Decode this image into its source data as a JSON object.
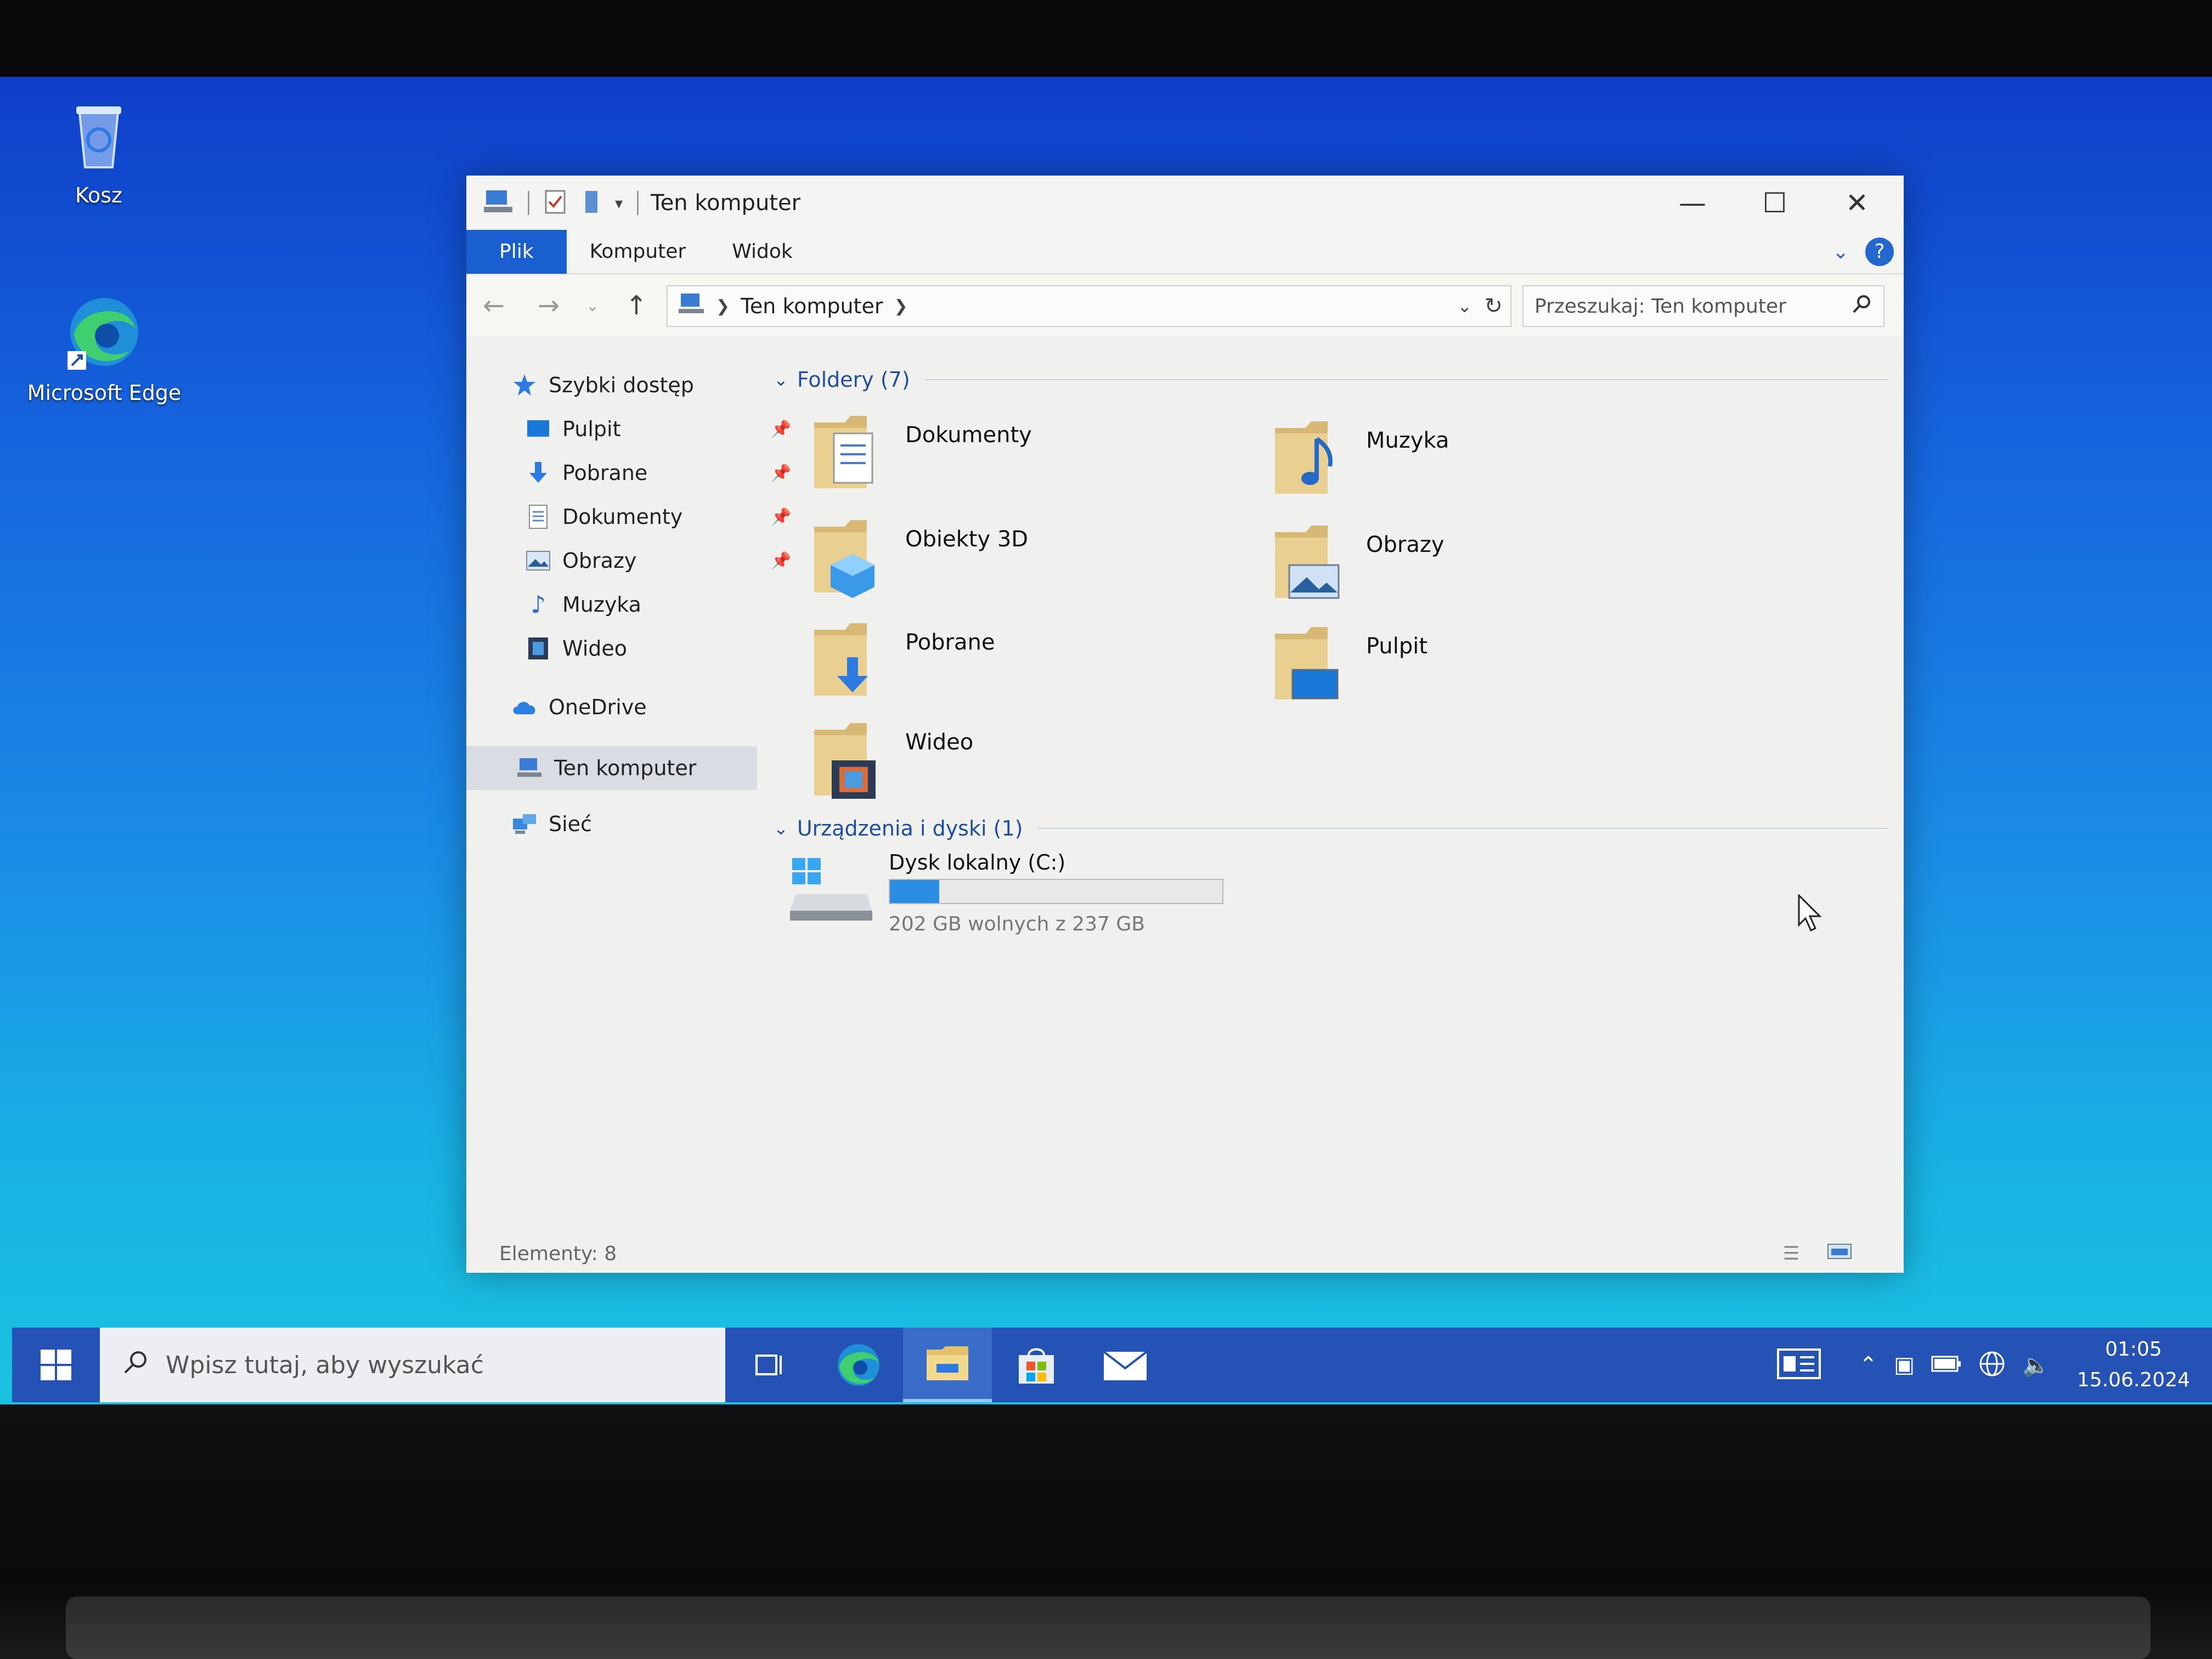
{
  "desktop": {
    "icons": [
      {
        "label": "Kosz",
        "icon": "recycle-bin-icon"
      },
      {
        "label": "Microsoft Edge",
        "icon": "edge-icon"
      }
    ]
  },
  "window": {
    "title": "Ten komputer",
    "ribbon_tabs": [
      "Plik",
      "Komputer",
      "Widok"
    ],
    "address": {
      "location": "Ten komputer"
    },
    "search_placeholder": "Przeszukaj: Ten komputer",
    "sidebar": {
      "quick_access": "Szybki dostęp",
      "quick_items": [
        "Pulpit",
        "Pobrane",
        "Dokumenty",
        "Obrazy",
        "Muzyka",
        "Wideo"
      ],
      "onedrive": "OneDrive",
      "this_pc": "Ten komputer",
      "network": "Sieć"
    },
    "folders_header": "Foldery (7)",
    "folders": [
      "Dokumenty",
      "Muzyka",
      "Obiekty 3D",
      "Obrazy",
      "Pobrane",
      "Pulpit",
      "Wideo"
    ],
    "devices_header": "Urządzenia i dyski (1)",
    "drive": {
      "name": "Dysk lokalny (C:)",
      "free_text": "202 GB wolnych z 237 GB",
      "used_fraction": 0.148
    },
    "status": "Elementy: 8"
  },
  "taskbar": {
    "search_placeholder": "Wpisz tutaj, aby wyszukać",
    "time": "01:05",
    "date": "15.06.2024"
  },
  "colors": {
    "accent": "#1a5fd0",
    "taskbar": "#2453b5",
    "drive_fill": "#2a8ce3"
  }
}
